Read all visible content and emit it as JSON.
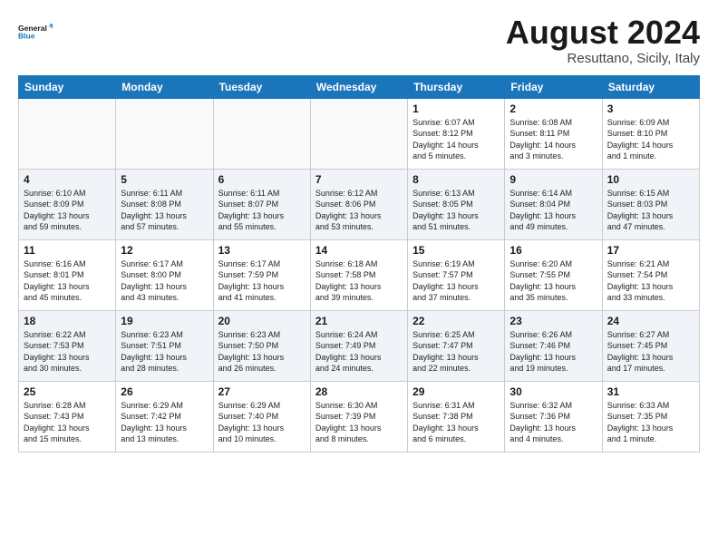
{
  "logo": {
    "text_general": "General",
    "text_blue": "Blue"
  },
  "title": "August 2024",
  "subtitle": "Resuttano, Sicily, Italy",
  "days_of_week": [
    "Sunday",
    "Monday",
    "Tuesday",
    "Wednesday",
    "Thursday",
    "Friday",
    "Saturday"
  ],
  "weeks": [
    [
      {
        "day": "",
        "info": ""
      },
      {
        "day": "",
        "info": ""
      },
      {
        "day": "",
        "info": ""
      },
      {
        "day": "",
        "info": ""
      },
      {
        "day": "1",
        "info": "Sunrise: 6:07 AM\nSunset: 8:12 PM\nDaylight: 14 hours\nand 5 minutes."
      },
      {
        "day": "2",
        "info": "Sunrise: 6:08 AM\nSunset: 8:11 PM\nDaylight: 14 hours\nand 3 minutes."
      },
      {
        "day": "3",
        "info": "Sunrise: 6:09 AM\nSunset: 8:10 PM\nDaylight: 14 hours\nand 1 minute."
      }
    ],
    [
      {
        "day": "4",
        "info": "Sunrise: 6:10 AM\nSunset: 8:09 PM\nDaylight: 13 hours\nand 59 minutes."
      },
      {
        "day": "5",
        "info": "Sunrise: 6:11 AM\nSunset: 8:08 PM\nDaylight: 13 hours\nand 57 minutes."
      },
      {
        "day": "6",
        "info": "Sunrise: 6:11 AM\nSunset: 8:07 PM\nDaylight: 13 hours\nand 55 minutes."
      },
      {
        "day": "7",
        "info": "Sunrise: 6:12 AM\nSunset: 8:06 PM\nDaylight: 13 hours\nand 53 minutes."
      },
      {
        "day": "8",
        "info": "Sunrise: 6:13 AM\nSunset: 8:05 PM\nDaylight: 13 hours\nand 51 minutes."
      },
      {
        "day": "9",
        "info": "Sunrise: 6:14 AM\nSunset: 8:04 PM\nDaylight: 13 hours\nand 49 minutes."
      },
      {
        "day": "10",
        "info": "Sunrise: 6:15 AM\nSunset: 8:03 PM\nDaylight: 13 hours\nand 47 minutes."
      }
    ],
    [
      {
        "day": "11",
        "info": "Sunrise: 6:16 AM\nSunset: 8:01 PM\nDaylight: 13 hours\nand 45 minutes."
      },
      {
        "day": "12",
        "info": "Sunrise: 6:17 AM\nSunset: 8:00 PM\nDaylight: 13 hours\nand 43 minutes."
      },
      {
        "day": "13",
        "info": "Sunrise: 6:17 AM\nSunset: 7:59 PM\nDaylight: 13 hours\nand 41 minutes."
      },
      {
        "day": "14",
        "info": "Sunrise: 6:18 AM\nSunset: 7:58 PM\nDaylight: 13 hours\nand 39 minutes."
      },
      {
        "day": "15",
        "info": "Sunrise: 6:19 AM\nSunset: 7:57 PM\nDaylight: 13 hours\nand 37 minutes."
      },
      {
        "day": "16",
        "info": "Sunrise: 6:20 AM\nSunset: 7:55 PM\nDaylight: 13 hours\nand 35 minutes."
      },
      {
        "day": "17",
        "info": "Sunrise: 6:21 AM\nSunset: 7:54 PM\nDaylight: 13 hours\nand 33 minutes."
      }
    ],
    [
      {
        "day": "18",
        "info": "Sunrise: 6:22 AM\nSunset: 7:53 PM\nDaylight: 13 hours\nand 30 minutes."
      },
      {
        "day": "19",
        "info": "Sunrise: 6:23 AM\nSunset: 7:51 PM\nDaylight: 13 hours\nand 28 minutes."
      },
      {
        "day": "20",
        "info": "Sunrise: 6:23 AM\nSunset: 7:50 PM\nDaylight: 13 hours\nand 26 minutes."
      },
      {
        "day": "21",
        "info": "Sunrise: 6:24 AM\nSunset: 7:49 PM\nDaylight: 13 hours\nand 24 minutes."
      },
      {
        "day": "22",
        "info": "Sunrise: 6:25 AM\nSunset: 7:47 PM\nDaylight: 13 hours\nand 22 minutes."
      },
      {
        "day": "23",
        "info": "Sunrise: 6:26 AM\nSunset: 7:46 PM\nDaylight: 13 hours\nand 19 minutes."
      },
      {
        "day": "24",
        "info": "Sunrise: 6:27 AM\nSunset: 7:45 PM\nDaylight: 13 hours\nand 17 minutes."
      }
    ],
    [
      {
        "day": "25",
        "info": "Sunrise: 6:28 AM\nSunset: 7:43 PM\nDaylight: 13 hours\nand 15 minutes."
      },
      {
        "day": "26",
        "info": "Sunrise: 6:29 AM\nSunset: 7:42 PM\nDaylight: 13 hours\nand 13 minutes."
      },
      {
        "day": "27",
        "info": "Sunrise: 6:29 AM\nSunset: 7:40 PM\nDaylight: 13 hours\nand 10 minutes."
      },
      {
        "day": "28",
        "info": "Sunrise: 6:30 AM\nSunset: 7:39 PM\nDaylight: 13 hours\nand 8 minutes."
      },
      {
        "day": "29",
        "info": "Sunrise: 6:31 AM\nSunset: 7:38 PM\nDaylight: 13 hours\nand 6 minutes."
      },
      {
        "day": "30",
        "info": "Sunrise: 6:32 AM\nSunset: 7:36 PM\nDaylight: 13 hours\nand 4 minutes."
      },
      {
        "day": "31",
        "info": "Sunrise: 6:33 AM\nSunset: 7:35 PM\nDaylight: 13 hours\nand 1 minute."
      }
    ]
  ]
}
